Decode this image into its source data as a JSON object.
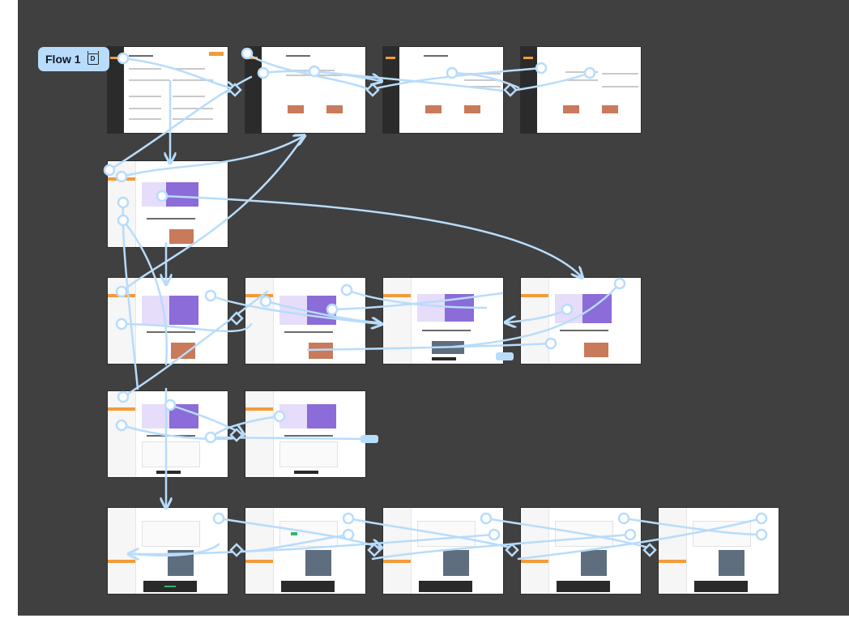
{
  "flow": {
    "label": "Flow 1",
    "icon": "present-icon",
    "icon_glyph": "D"
  },
  "colors": {
    "canvas": "#404040",
    "wire": "#b8dcfb",
    "accent": "#f39b3a",
    "hero": "#8b6cd9"
  },
  "frames_count_note": ""
}
